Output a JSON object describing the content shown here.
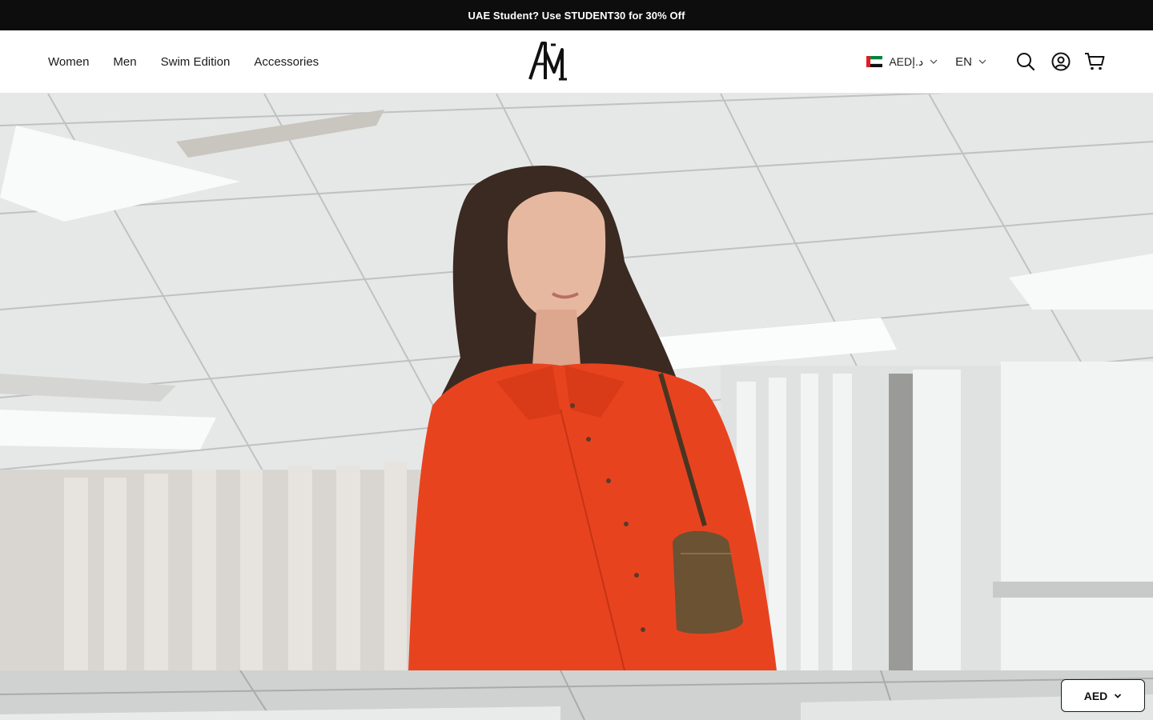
{
  "promo": {
    "text": "UAE Student? Use STUDENT30 for 30% Off"
  },
  "nav": {
    "items": [
      {
        "label": "Women"
      },
      {
        "label": "Men"
      },
      {
        "label": "Swim Edition"
      },
      {
        "label": "Accessories"
      }
    ]
  },
  "brand": {
    "logo_icon": "am-monogram-logo"
  },
  "header": {
    "currency_label": "AEDد.إ",
    "language_label": "EN",
    "flag_icon": "uae-flag-icon",
    "icons": [
      "search-icon",
      "account-icon",
      "cart-icon"
    ]
  },
  "hero": {
    "image": "woman-in-orange-shirt-with-brown-shoulder-bag-in-office"
  },
  "floating_currency": {
    "label": "AED"
  },
  "colors": {
    "promo_bg": "#0d0d0d",
    "promo_text": "#ffffff",
    "shirt_orange": "#e8431f",
    "uae_red": "#e21b24",
    "uae_green": "#00843d"
  }
}
